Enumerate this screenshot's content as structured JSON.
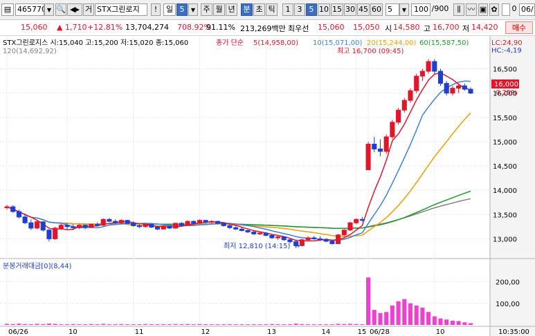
{
  "toolbar": {
    "code": "465770",
    "name_btn": "거",
    "name": "STX그린로지",
    "mark": "!",
    "period_day": "일",
    "period_num": "5",
    "periods": [
      "주",
      "월",
      "년",
      "분",
      "초",
      "틱"
    ],
    "minutes": [
      "1",
      "3",
      "5",
      "10",
      "15",
      "30",
      "45",
      "60"
    ],
    "count": "5",
    "view": "100",
    "total": "/900",
    "check_label": "0",
    "date_part": "06/"
  },
  "quote": {
    "price": "15,060",
    "change": "1,710",
    "rate": "+12.81%",
    "volume": "13,704,274",
    "vol_rate": "708.92%",
    "ratio": "91.11%",
    "amount": "213,269백만",
    "best_label": "최우선",
    "ask": "15,060",
    "bid": "15,050",
    "low_label_si": "시",
    "open": "14,580",
    "high_label": "고",
    "high": "16,700",
    "low_label": "저",
    "low": "14,420",
    "buy": "매수"
  },
  "legend": {
    "info": "STX그린로지스 시:15,040 고:15,200 저:15,020 종:15,060",
    "ma_title": "종가 단순",
    "ma5": "5(14,958,00)",
    "ma10": "10(15,071,00)",
    "ma20": "20(15,244,00)",
    "ma60": "60(15,587,50)",
    "ma120": "120(14,692,92)",
    "lc": "LC:24,90",
    "hc": "HC:-4,19",
    "max_label": "최고 16,700 (09:45)",
    "min_label": "최저 12,810 (14:15)",
    "current": "16,000",
    "current_rate": "0,25%",
    "volume_title": "분봉거래대금[0](8,44)"
  },
  "axis": {
    "price_ticks": [
      "16,500",
      "16,000",
      "15,500",
      "15,000",
      "14,500",
      "14,000",
      "13,500",
      "13,000"
    ],
    "vol_ticks": [
      "200,00",
      "100,00"
    ],
    "time_labels": [
      "06/26",
      "10",
      "11",
      "12",
      "13",
      "14",
      "15",
      "06/28",
      "10"
    ],
    "end_time": "10:35:00"
  },
  "colors": {
    "up": "#e0162b",
    "down": "#1f3fd0",
    "ma5": "#e0162b",
    "ma10": "#3f7fe0",
    "ma20": "#e8a000",
    "ma60": "#1e9a2a",
    "ma120": "#808080",
    "volume": "#f040d0"
  },
  "chart_data": {
    "type": "candlestick",
    "price_range": [
      12650,
      16750
    ],
    "volume_range": [
      0,
      250
    ],
    "candles": [
      [
        13640,
        13700,
        13600,
        13660
      ],
      [
        13660,
        13690,
        13540,
        13560
      ],
      [
        13560,
        13600,
        13420,
        13450
      ],
      [
        13450,
        13520,
        13300,
        13330
      ],
      [
        13330,
        13400,
        13180,
        13220
      ],
      [
        13220,
        13380,
        13200,
        13350
      ],
      [
        13350,
        13360,
        13150,
        13180
      ],
      [
        13180,
        13200,
        12950,
        13000
      ],
      [
        13000,
        13250,
        12980,
        13220
      ],
      [
        13220,
        13320,
        13180,
        13280
      ],
      [
        13280,
        13330,
        13200,
        13250
      ],
      [
        13250,
        13300,
        13180,
        13230
      ],
      [
        13230,
        13300,
        13200,
        13280
      ],
      [
        13280,
        13290,
        13200,
        13240
      ],
      [
        13240,
        13310,
        13220,
        13300
      ],
      [
        13300,
        13340,
        13250,
        13280
      ],
      [
        13280,
        13420,
        13260,
        13400
      ],
      [
        13400,
        13430,
        13340,
        13360
      ],
      [
        13360,
        13400,
        13300,
        13330
      ],
      [
        13330,
        13400,
        13300,
        13380
      ],
      [
        13380,
        13390,
        13300,
        13320
      ],
      [
        13320,
        13360,
        13250,
        13270
      ],
      [
        13270,
        13300,
        13220,
        13250
      ],
      [
        13250,
        13320,
        13230,
        13300
      ],
      [
        13300,
        13310,
        13220,
        13240
      ],
      [
        13240,
        13260,
        13180,
        13200
      ],
      [
        13200,
        13280,
        13190,
        13260
      ],
      [
        13260,
        13270,
        13200,
        13220
      ],
      [
        13220,
        13330,
        13210,
        13320
      ],
      [
        13320,
        13340,
        13260,
        13280
      ],
      [
        13280,
        13380,
        13270,
        13360
      ],
      [
        13360,
        13380,
        13300,
        13320
      ],
      [
        13320,
        13400,
        13310,
        13380
      ],
      [
        13380,
        13390,
        13320,
        13340
      ],
      [
        13340,
        13380,
        13300,
        13360
      ],
      [
        13360,
        13370,
        13300,
        13320
      ],
      [
        13320,
        13340,
        13250,
        13270
      ],
      [
        13270,
        13300,
        13200,
        13230
      ],
      [
        13230,
        13260,
        13180,
        13200
      ],
      [
        13200,
        13240,
        13150,
        13170
      ],
      [
        13170,
        13200,
        13120,
        13140
      ],
      [
        13140,
        13160,
        13080,
        13100
      ],
      [
        13100,
        13150,
        13080,
        13120
      ],
      [
        13120,
        13140,
        13050,
        13070
      ],
      [
        13070,
        13100,
        13000,
        13020
      ],
      [
        13020,
        13060,
        12980,
        13040
      ],
      [
        13040,
        13050,
        12960,
        12980
      ],
      [
        12980,
        13020,
        12900,
        12940
      ],
      [
        12940,
        12980,
        12810,
        12860
      ],
      [
        12860,
        13000,
        12840,
        12980
      ],
      [
        12980,
        13050,
        12950,
        13020
      ],
      [
        13020,
        13060,
        12980,
        13000
      ],
      [
        13000,
        13050,
        12960,
        12990
      ],
      [
        12990,
        13010,
        12930,
        12950
      ],
      [
        12950,
        12980,
        12880,
        12900
      ],
      [
        12900,
        13100,
        12890,
        13080
      ],
      [
        13080,
        13200,
        13050,
        13180
      ],
      [
        13180,
        13350,
        13160,
        13330
      ],
      [
        13330,
        13420,
        13300,
        13400
      ],
      [
        13400,
        13450,
        13350,
        13380
      ],
      [
        14420,
        15000,
        14420,
        14950
      ],
      [
        14950,
        15100,
        14780,
        14850
      ],
      [
        14850,
        15050,
        14700,
        14800
      ],
      [
        14800,
        15150,
        14750,
        15100
      ],
      [
        15100,
        15450,
        15050,
        15400
      ],
      [
        15400,
        15700,
        15350,
        15650
      ],
      [
        15650,
        15900,
        15600,
        15850
      ],
      [
        15850,
        16100,
        15800,
        16050
      ],
      [
        16050,
        16400,
        16000,
        16350
      ],
      [
        16350,
        16500,
        16250,
        16450
      ],
      [
        16450,
        16700,
        16400,
        16650
      ],
      [
        16650,
        16700,
        16400,
        16450
      ],
      [
        16450,
        16500,
        16150,
        16200
      ],
      [
        16200,
        16250,
        15950,
        16000
      ],
      [
        16000,
        16150,
        15950,
        16100
      ],
      [
        16100,
        16200,
        16000,
        16150
      ],
      [
        16150,
        16200,
        16050,
        16080
      ],
      [
        16080,
        16120,
        15980,
        16000
      ]
    ],
    "volumes": [
      5,
      4,
      6,
      4,
      3,
      5,
      4,
      6,
      5,
      3,
      3,
      4,
      3,
      3,
      4,
      3,
      5,
      3,
      3,
      4,
      3,
      3,
      3,
      4,
      3,
      3,
      3,
      3,
      4,
      3,
      4,
      3,
      4,
      3,
      3,
      3,
      3,
      3,
      3,
      3,
      3,
      3,
      3,
      3,
      4,
      3,
      3,
      3,
      6,
      4,
      3,
      3,
      3,
      3,
      3,
      5,
      4,
      5,
      4,
      3,
      220,
      70,
      55,
      60,
      90,
      110,
      120,
      100,
      90,
      80,
      60,
      40,
      30,
      25,
      20,
      18,
      12,
      8
    ]
  }
}
